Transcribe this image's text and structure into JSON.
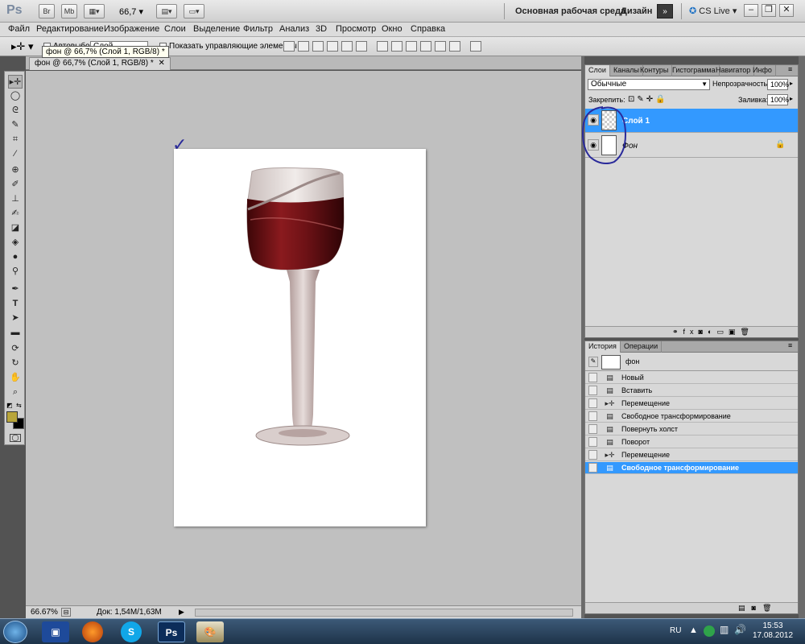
{
  "app": {
    "logo": "Ps",
    "zoom_field": "66,7",
    "workspace_label": "Основная рабочая среда",
    "design_label": "Дизайн",
    "more_label": "»",
    "cslive_label": "CS Live",
    "top_buttons": [
      "Br",
      "Mb"
    ],
    "window_controls": [
      "–",
      "❐",
      "✕"
    ]
  },
  "menu": [
    "Файл",
    "Редактирование",
    "Изображение",
    "Слои",
    "Выделение",
    "Фильтр",
    "Анализ",
    "3D",
    "Просмотр",
    "Окно",
    "Справка"
  ],
  "options": {
    "autoselect_label": "Автовыбор:",
    "autoselect_value": "Слой",
    "show_controls_label": "Показать управляющие элементы"
  },
  "document": {
    "tab_label": "фон @ 66,7% (Слой 1, RGB/8) *",
    "tooltip": "фон @ 66,7% (Слой 1, RGB/8) *",
    "annotation": "✓"
  },
  "status": {
    "zoom": "66.67%",
    "doc_info": "Док: 1,54M/1,63M"
  },
  "layers_panel": {
    "tabs": [
      "Слои",
      "Каналы",
      "Контуры",
      "Гистограмма",
      "Навигатор",
      "Инфо"
    ],
    "blend_mode": "Обычные",
    "opacity_label": "Непрозрачность:",
    "opacity_value": "100%",
    "lock_label": "Закрепить:",
    "fill_label": "Заливка:",
    "fill_value": "100%",
    "layers": [
      {
        "name": "Слой 1",
        "selected": true
      },
      {
        "name": "Фон",
        "selected": false
      }
    ],
    "selection_color": "#3399ff"
  },
  "history_panel": {
    "tabs": [
      "История",
      "Операции"
    ],
    "snapshot": "фон",
    "items": [
      {
        "label": "Новый",
        "icon": "doc-icon"
      },
      {
        "label": "Вставить",
        "icon": "doc-icon"
      },
      {
        "label": "Перемещение",
        "icon": "move-icon"
      },
      {
        "label": "Свободное трансформирование",
        "icon": "doc-icon"
      },
      {
        "label": "Повернуть холст",
        "icon": "doc-icon"
      },
      {
        "label": "Поворот",
        "icon": "doc-icon"
      },
      {
        "label": "Перемещение",
        "icon": "move-icon"
      },
      {
        "label": "Свободное трансформирование",
        "icon": "doc-icon",
        "selected": true
      }
    ]
  },
  "taskbar": {
    "lang": "RU",
    "time": "15:53",
    "date": "17.08.2012",
    "apps": [
      "Ps"
    ]
  }
}
